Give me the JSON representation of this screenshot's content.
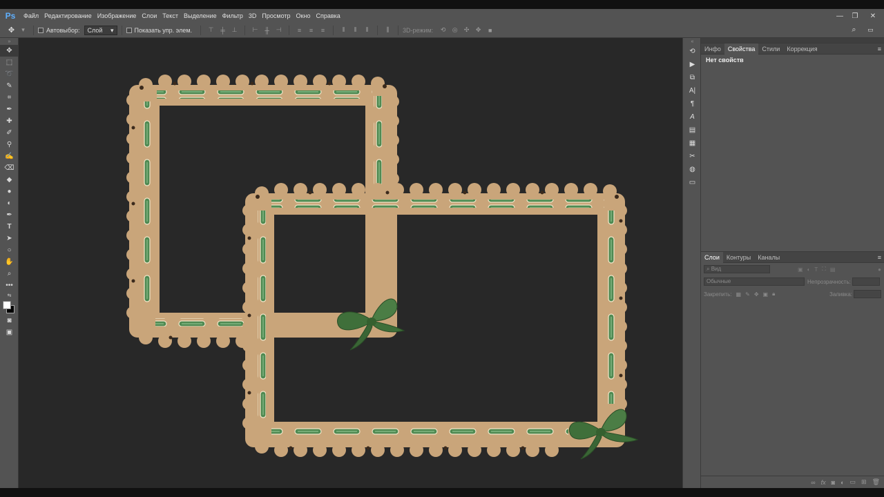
{
  "app": {
    "logo": "Ps"
  },
  "menu": [
    "Файл",
    "Редактирование",
    "Изображение",
    "Слои",
    "Текст",
    "Выделение",
    "Фильтр",
    "3D",
    "Просмотр",
    "Окно",
    "Справка"
  ],
  "window_controls": {
    "minimize": "—",
    "restore": "❐",
    "close": "✕"
  },
  "options": {
    "autoselect_label": "Автовыбор:",
    "autoselect_value": "Слой",
    "show_transform_label": "Показать упр. элем.",
    "mode3d_label": "3D-режим:"
  },
  "properties_panel": {
    "tabs": [
      "Инфо",
      "Свойства",
      "Стили",
      "Коррекция"
    ],
    "active_tab": "Свойства",
    "content": "Нет свойств"
  },
  "layers_panel": {
    "tabs": [
      "Слои",
      "Контуры",
      "Каналы"
    ],
    "active_tab": "Слои",
    "search_placeholder": "Вид",
    "blend_mode": "Обычные",
    "opacity_label": "Непрозрачность:",
    "lock_label": "Закрепить:",
    "fill_label": "Заливка:"
  },
  "colors": {
    "frame": "#c9a57a",
    "frame_dark": "#a88558",
    "ribbon": "#4f8a52",
    "bow": "#3f6f3a",
    "canvas": "#282828",
    "panel": "#535353"
  }
}
